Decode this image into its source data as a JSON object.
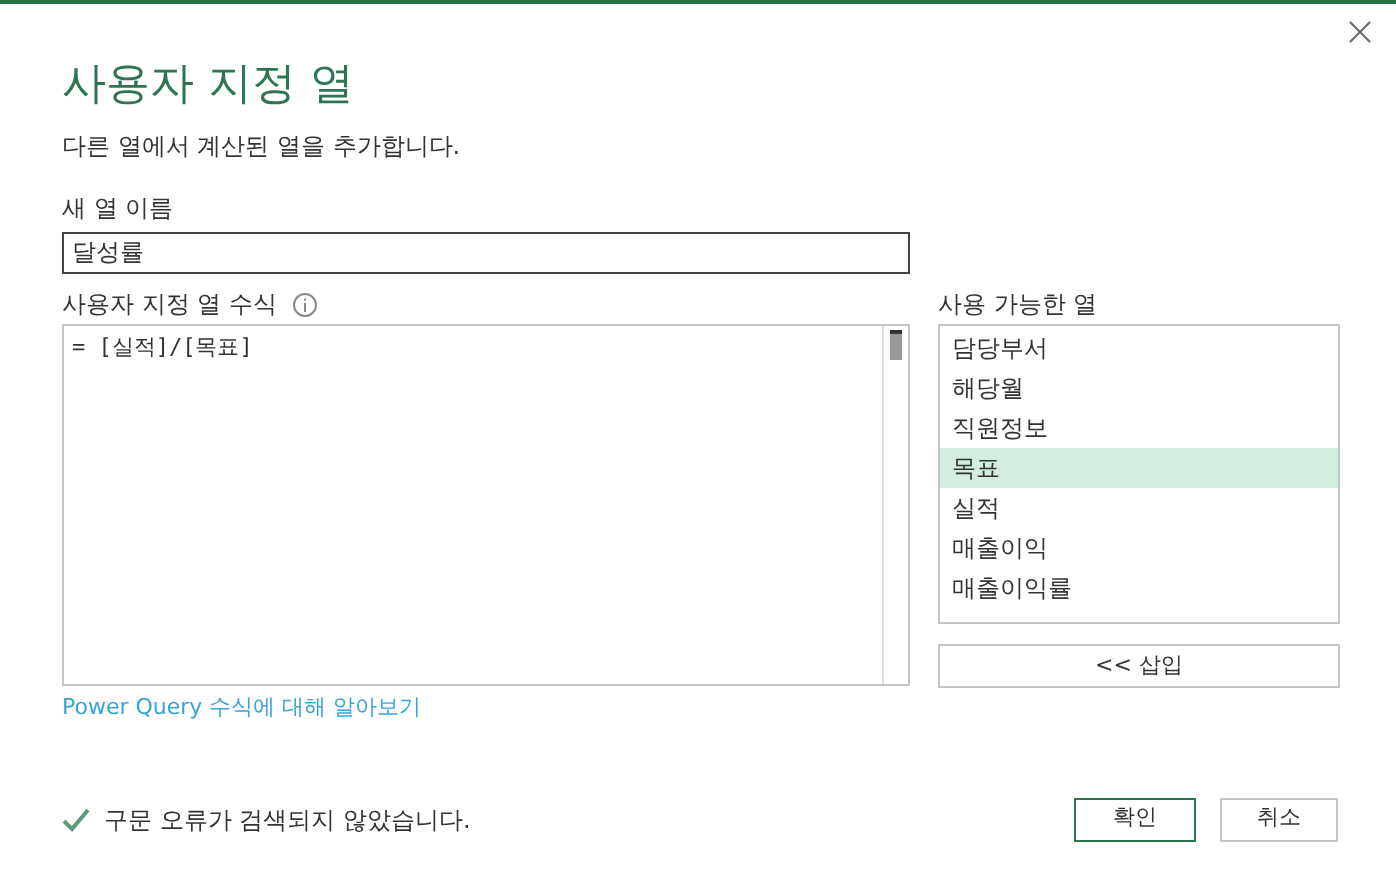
{
  "dialog": {
    "title": "사용자 지정 열",
    "subtitle": "다른 열에서 계산된 열을 추가합니다."
  },
  "new_column_name": {
    "label": "새 열 이름",
    "value": "달성률"
  },
  "formula": {
    "label": "사용자 지정 열 수식",
    "value": "= [실적]/[목표]"
  },
  "available_columns": {
    "label": "사용 가능한 열",
    "items": [
      {
        "label": "담당부서",
        "selected": false
      },
      {
        "label": "해당월",
        "selected": false
      },
      {
        "label": "직원정보",
        "selected": false
      },
      {
        "label": "목표",
        "selected": true
      },
      {
        "label": "실적",
        "selected": false
      },
      {
        "label": "매출이익",
        "selected": false
      },
      {
        "label": "매출이익률",
        "selected": false
      }
    ],
    "insert_button": "<< 삽입"
  },
  "help_link": "Power Query 수식에 대해 알아보기",
  "status": "구문 오류가 검색되지 않았습니다.",
  "buttons": [
    {
      "label": "확인",
      "kind": "primary"
    },
    {
      "label": "취소",
      "kind": "secondary"
    }
  ]
}
